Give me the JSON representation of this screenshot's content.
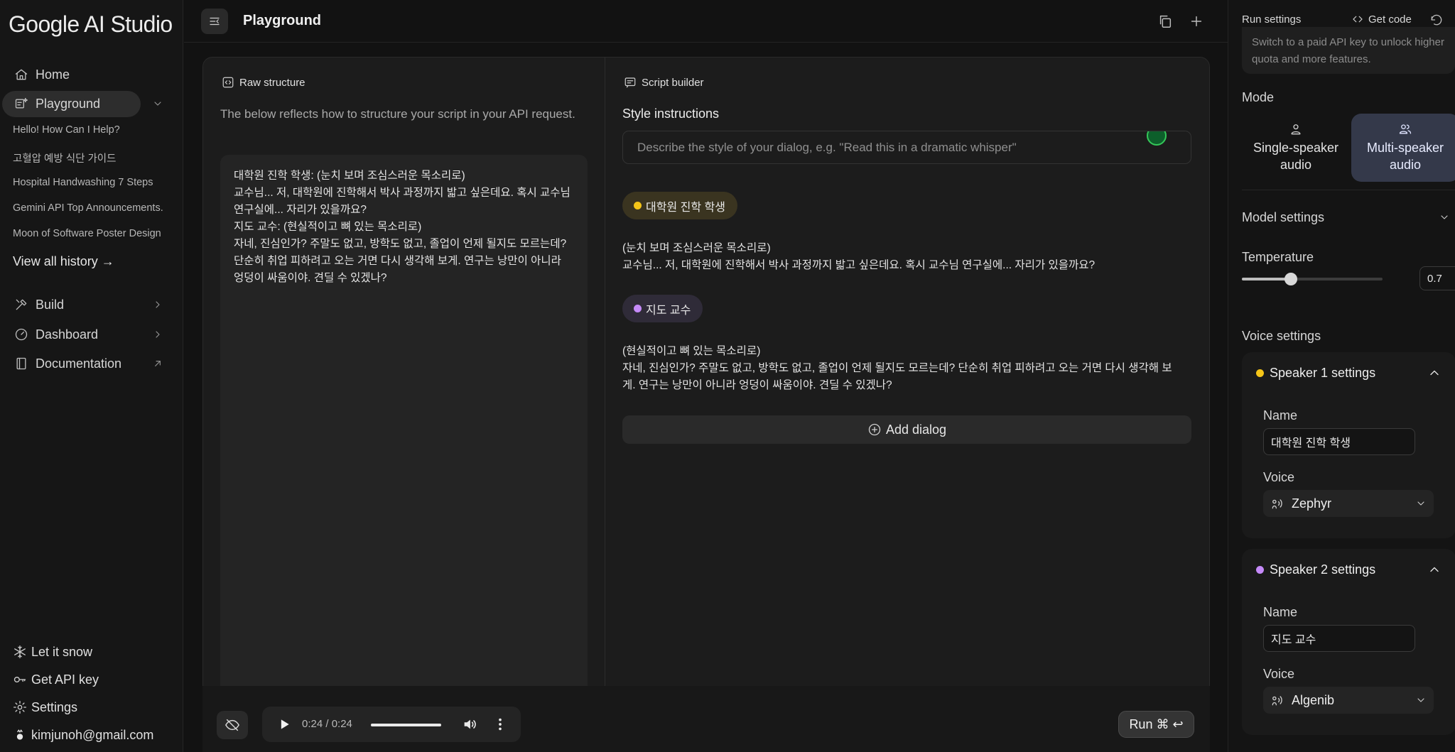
{
  "app": {
    "logo": "Google AI Studio"
  },
  "sidebar": {
    "nav": [
      {
        "label": "Home",
        "icon": "home-icon"
      },
      {
        "label": "Playground",
        "icon": "playground-icon"
      }
    ],
    "history": [
      "Hello! How Can I Help?",
      "고혈압 예방 식단 가이드",
      "Hospital Handwashing 7 Steps",
      "Gemini API Top Announcements.",
      "Moon of Software Poster Design"
    ],
    "view_all": "View all history →",
    "sections": [
      {
        "label": "Build",
        "icon": "build-icon"
      },
      {
        "label": "Dashboard",
        "icon": "dashboard-icon"
      },
      {
        "label": "Documentation",
        "icon": "documentation-icon"
      }
    ],
    "bottom": [
      {
        "label": "Let it snow",
        "icon": "snowflake-icon"
      },
      {
        "label": "Get API key",
        "icon": "key-icon"
      },
      {
        "label": "Settings",
        "icon": "gear-icon"
      },
      {
        "label": "kimjunoh@gmail.com",
        "icon": "account-icon"
      }
    ]
  },
  "header": {
    "title": "Playground"
  },
  "raw": {
    "title": "Raw structure",
    "description": "The below reflects how to structure your script in your API request.",
    "script": "대학원 진학 학생: (눈치 보며 조심스러운 목소리로)\n교수님... 저, 대학원에 진학해서 박사 과정까지 밟고 싶은데요. 혹시 교수님 연구실에... 자리가 있을까요?\n지도 교수: (현실적이고 뼈 있는 목소리로)\n자네, 진심인가? 주말도 없고, 방학도 없고, 졸업이 언제 될지도 모르는데? 단순히 취업 피하려고 오는 거면 다시 생각해 보게. 연구는 낭만이 아니라 엉덩이 싸움이야. 견딜 수 있겠나?"
  },
  "builder": {
    "title": "Script builder",
    "style_label": "Style instructions",
    "style_placeholder": "Describe the style of your dialog, e.g. \"Read this in a dramatic whisper\"",
    "dialogs": [
      {
        "speaker": "대학원 진학 학생",
        "color": "#f5c518",
        "chip_bg": "#3a3420",
        "text": "(눈치 보며 조심스러운 목소리로)\n교수님... 저, 대학원에 진학해서 박사 과정까지 밟고 싶은데요. 혹시 교수님 연구실에... 자리가 있을까요?"
      },
      {
        "speaker": "지도 교수",
        "color": "#c58af9",
        "chip_bg": "#2f2b38",
        "text": "(현실적이고 뼈 있는 목소리로)\n자네, 진심인가? 주말도 없고, 방학도 없고, 졸업이 언제 될지도 모르는데? 단순히 취업 피하려고 오는 거면 다시 생각해 보게. 연구는 낭만이 아니라 엉덩이 싸움이야. 견딜 수 있겠나?"
      }
    ],
    "add_dialog": "Add dialog"
  },
  "player": {
    "time": "0:24 / 0:24",
    "progress": 1.0,
    "run_label": "Run ⌘ ↩"
  },
  "settings": {
    "title": "Run settings",
    "get_code": "Get code",
    "notice": "Switch to a paid API key to unlock higher quota and more features.",
    "mode_label": "Mode",
    "mode_single": "Single-speaker audio",
    "mode_multi": "Multi-speaker audio",
    "model_settings": "Model settings",
    "temperature_label": "Temperature",
    "temperature": "0.7",
    "temperature_value": 0.7,
    "temperature_max": 2.0,
    "voice_settings": "Voice settings",
    "speakers": [
      {
        "title": "Speaker 1 settings",
        "color": "#f5c518",
        "name_label": "Name",
        "name": "대학원 진학 학생",
        "voice_label": "Voice",
        "voice": "Zephyr"
      },
      {
        "title": "Speaker 2 settings",
        "color": "#c58af9",
        "name_label": "Name",
        "name": "지도 교수",
        "voice_label": "Voice",
        "voice": "Algenib"
      }
    ]
  },
  "colors": {
    "accent_multi": "#34394a",
    "status_green": "#34c759"
  }
}
